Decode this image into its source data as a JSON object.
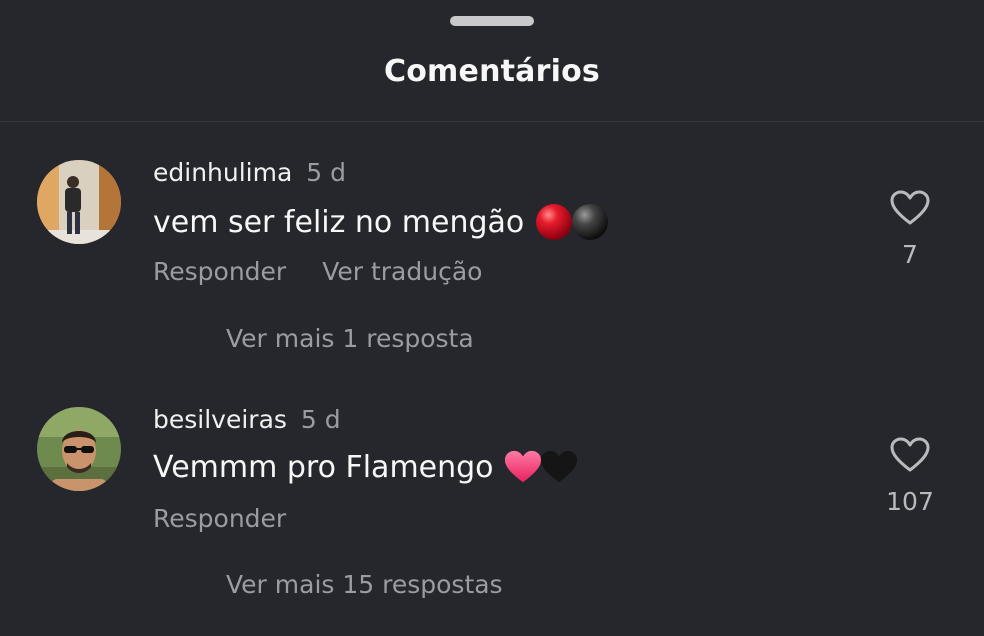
{
  "sheet": {
    "title": "Comentários"
  },
  "comments": [
    {
      "username": "edinhulima",
      "age": "5 d",
      "text": "vem ser feliz no mengão",
      "emojis": [
        "red-circle-icon",
        "black-circle-icon"
      ],
      "reply_label": "Responder",
      "translate_label": "Ver tradução",
      "more_replies": "Ver mais 1 resposta",
      "likes": "7"
    },
    {
      "username": "besilveiras",
      "age": "5 d",
      "text": "Vemmm pro Flamengo",
      "emojis": [
        "pink-heart-icon",
        "black-heart-icon"
      ],
      "reply_label": "Responder",
      "more_replies": "Ver mais 15 respostas",
      "likes": "107"
    }
  ],
  "colors": {
    "background": "#25272c",
    "primary_text": "#f7f7f7",
    "secondary_text": "#9a9ca1",
    "red_emoji": "#e0182a",
    "pink_heart": "#ff3d7a"
  }
}
